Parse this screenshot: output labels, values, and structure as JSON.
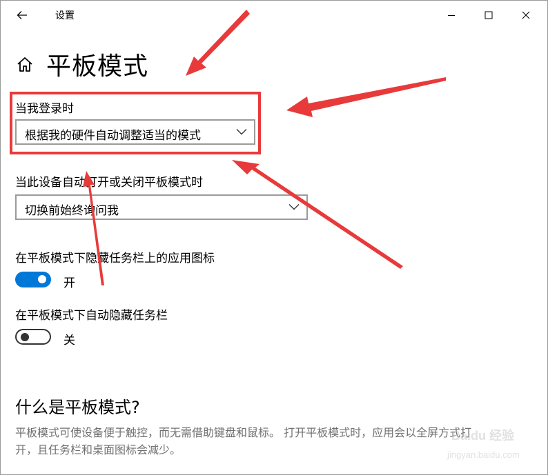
{
  "window": {
    "title": "设置",
    "icons": {
      "back": "back-arrow-icon",
      "minimize": "minimize-icon",
      "maximize": "maximize-icon",
      "close": "close-icon"
    }
  },
  "page": {
    "icon": "home-icon",
    "title": "平板模式"
  },
  "settings": {
    "login_label": "当我登录时",
    "login_value": "根据我的硬件自动调整适当的模式",
    "auto_switch_label": "当此设备自动打开或关闭平板模式时",
    "auto_switch_value": "切换前始终询问我",
    "hide_icons_label": "在平板模式下隐藏任务栏上的应用图标",
    "hide_icons_state": "开",
    "hide_icons_on": true,
    "auto_hide_label": "在平板模式下自动隐藏任务栏",
    "auto_hide_state": "关",
    "auto_hide_on": false
  },
  "about": {
    "heading": "什么是平板模式?",
    "line1": "平板模式可使设备便于触控，而无需借助键盘和鼠标。 打开平板模式时，应用会以全屏方式打",
    "line2": "开，且任务栏和桌面图标会减少。"
  },
  "watermark": {
    "text1": "Baidu 经验",
    "text2": "jingyan.baidu.com"
  },
  "colors": {
    "accent": "#0078d7",
    "annotation": "#e83a3a",
    "secondary_text": "#707070"
  }
}
